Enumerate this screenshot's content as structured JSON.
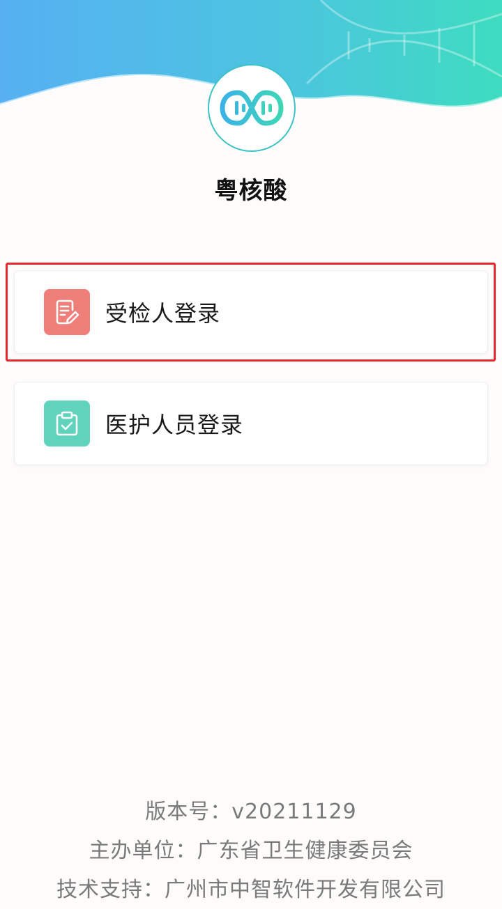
{
  "app": {
    "title": "粤核酸"
  },
  "login_options": [
    {
      "label": "受检人登录",
      "icon": "edit-document-icon",
      "icon_color": "#ef7f79",
      "highlighted": true
    },
    {
      "label": "医护人员登录",
      "icon": "clipboard-check-icon",
      "icon_color": "#5fd3bc",
      "highlighted": false
    }
  ],
  "footer": {
    "version": "版本号：v20211129",
    "organizer": "主办单位：广东省卫生健康委员会",
    "tech_support": "技术支持：广州市中智软件开发有限公司"
  },
  "colors": {
    "header_gradient_start": "#4fb3f0",
    "header_gradient_end": "#3fd9c0",
    "highlight_border": "#e8272a",
    "logo_accent": "#3dc3c4"
  }
}
